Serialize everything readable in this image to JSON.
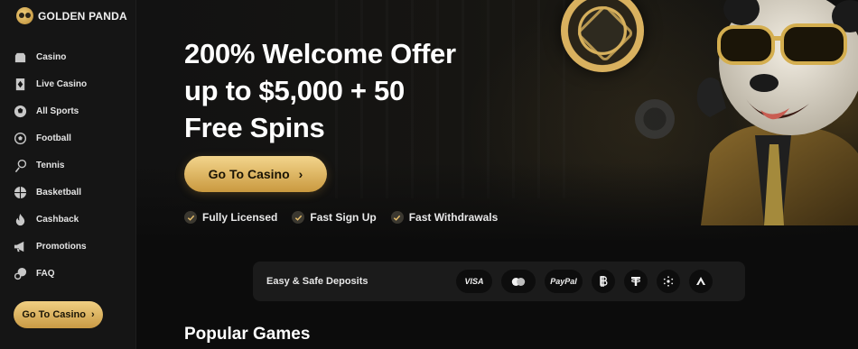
{
  "brand": {
    "name": "GOLDEN PANDA"
  },
  "sidebar": {
    "items": [
      {
        "label": "Casino",
        "icon": "casino-icon"
      },
      {
        "label": "Live Casino",
        "icon": "live-casino-icon"
      },
      {
        "label": "All Sports",
        "icon": "all-sports-icon"
      },
      {
        "label": "Football",
        "icon": "football-icon"
      },
      {
        "label": "Tennis",
        "icon": "tennis-icon"
      },
      {
        "label": "Basketball",
        "icon": "basketball-icon"
      },
      {
        "label": "Cashback",
        "icon": "flame-icon"
      },
      {
        "label": "Promotions",
        "icon": "megaphone-icon"
      },
      {
        "label": "FAQ",
        "icon": "chat-icon"
      }
    ],
    "cta_label": "Go To Casino",
    "cta_chevron": "›"
  },
  "hero": {
    "title_lines": [
      "200% Welcome Offer",
      "up to $5,000 + 50",
      "Free Spins"
    ],
    "cta_label": "Go To Casino",
    "cta_chevron": "›",
    "features": [
      "Fully Licensed",
      "Fast Sign Up",
      "Fast Withdrawals"
    ]
  },
  "deposits": {
    "label": "Easy & Safe Deposits",
    "methods": [
      {
        "label": "VISA",
        "icon": "visa-icon"
      },
      {
        "label": "",
        "icon": "mastercard-icon"
      },
      {
        "label": "PayPal",
        "icon": "paypal-icon"
      },
      {
        "label": "",
        "icon": "bitcoin-icon"
      },
      {
        "label": "",
        "icon": "tether-icon"
      },
      {
        "label": "",
        "icon": "cardano-icon"
      },
      {
        "label": "",
        "icon": "arbitrum-icon"
      }
    ]
  },
  "popular_games": {
    "title": "Popular Games"
  },
  "colors": {
    "accent_gold": "#e6bd6a",
    "background": "#0c0c0c",
    "sidebar": "#151515"
  }
}
